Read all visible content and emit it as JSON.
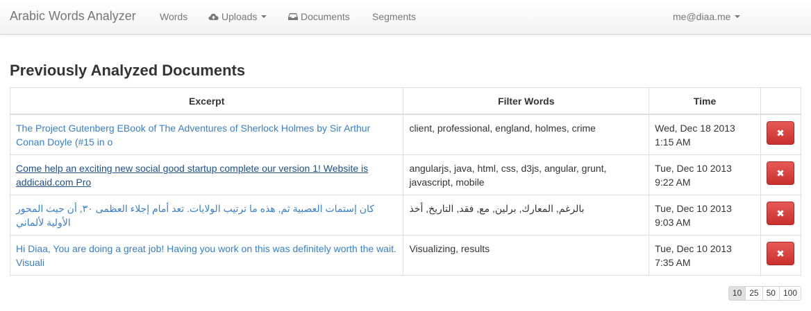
{
  "navbar": {
    "brand": "Arabic Words Analyzer",
    "items": [
      {
        "label": "Words",
        "icon": ""
      },
      {
        "label": "Uploads",
        "icon": "cloud-upload-icon",
        "dropdown": true
      },
      {
        "label": "Documents",
        "icon": "inbox-icon"
      },
      {
        "label": "Segments",
        "icon": ""
      }
    ],
    "user": "me@diaa.me"
  },
  "page": {
    "title": "Previously Analyzed Documents"
  },
  "table": {
    "headers": {
      "excerpt": "Excerpt",
      "filter": "Filter Words",
      "time": "Time",
      "action": ""
    },
    "rows": [
      {
        "excerpt": "The Project Gutenberg EBook of The Adventures of Sherlock Holmes by Sir Arthur Conan Doyle (#15 in o",
        "filter": "client, professional, england, holmes, crime",
        "date": "Wed, Dec 18 2013",
        "clock": "1:15 AM",
        "delete_label": "✖"
      },
      {
        "excerpt": "Come help an exciting new social good startup complete our version 1! Website is addicaid.com Pro",
        "filter": "angularjs, java, html, css, d3js, angular, grunt, javascript, mobile",
        "date": "Tue, Dec 10 2013",
        "clock": "9:22 AM",
        "delete_label": "✖"
      },
      {
        "excerpt": "كان إستمات العصبية ثم, هذه ما ترتيب الولايات. تعد أمام إجلاء العظمى ٣٠, أن حيث المحور الأولية لألماني",
        "filter": "بالرغم, المعارك, برلين, مع, فقد, التاريخ, أخذ",
        "date": "Tue, Dec 10 2013",
        "clock": "9:03 AM",
        "delete_label": "✖"
      },
      {
        "excerpt": "Hi Diaa, You are doing a great job! Having you work on this was definitely worth the wait. Visuali",
        "filter": "Visualizing, results",
        "date": "Tue, Dec 10 2013",
        "clock": "7:35 AM",
        "delete_label": "✖"
      }
    ]
  },
  "pager": {
    "sizes": [
      "10",
      "25",
      "50",
      "100"
    ],
    "selected": "10"
  },
  "colors": {
    "link": "#3a7fc4",
    "danger": "#d9534f"
  }
}
